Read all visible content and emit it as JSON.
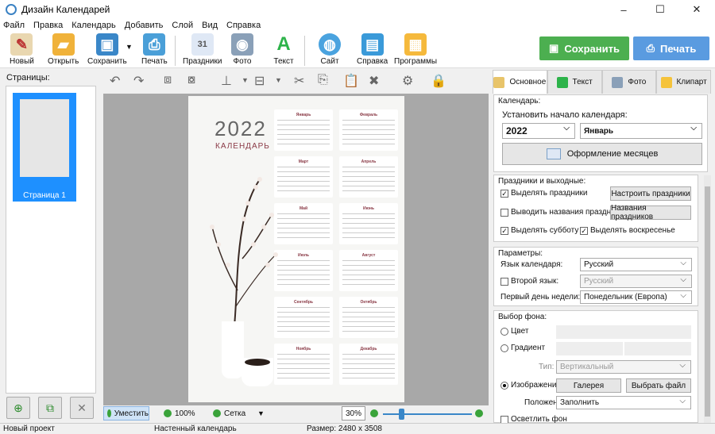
{
  "window": {
    "title": "Дизайн Календарей",
    "controls": [
      "–",
      "☐",
      "✕"
    ]
  },
  "menu": [
    "Файл",
    "Правка",
    "Календарь",
    "Добавить",
    "Слой",
    "Вид",
    "Справка"
  ],
  "toolbar": {
    "new": "Новый",
    "open": "Открыть",
    "save": "Сохранить",
    "print": "Печать",
    "holidays": "Праздники",
    "photo": "Фото",
    "text": "Текст",
    "site": "Сайт",
    "help": "Справка",
    "programs": "Программы",
    "save_big": "Сохранить",
    "print_big": "Печать"
  },
  "colors": {
    "save_big": "#4caf50",
    "print_big": "#5a9be0",
    "accent": "#1e90ff"
  },
  "left": {
    "pages_label": "Страницы:",
    "page1": "Страница 1"
  },
  "poster": {
    "year": "2022",
    "subtitle": "КАЛЕНДАРЬ",
    "months": [
      "Январь",
      "Февраль",
      "Март",
      "Апрель",
      "Май",
      "Июнь",
      "Июль",
      "Август",
      "Сентябрь",
      "Октябрь",
      "Ноябрь",
      "Декабрь"
    ]
  },
  "bottom": {
    "fit": "Уместить",
    "zoom100": "100%",
    "grid": "Сетка",
    "zoom": "30%"
  },
  "tabs": [
    "Основное",
    "Текст",
    "Фото",
    "Клипарт"
  ],
  "calendar": {
    "label": "Календарь:",
    "start_label": "Установить начало календаря:",
    "year": "2022",
    "month": "Январь",
    "design_btn": "Оформление месяцев"
  },
  "holidays": {
    "label": "Праздники и выходные:",
    "highlight": "Выделять праздники",
    "setup_btn": "Настроить праздники",
    "show_names": "Выводить названия праздников",
    "names_btn": "Названия праздников",
    "saturday": "Выделять субботу",
    "sunday": "Выделять воскресенье"
  },
  "params": {
    "label": "Параметры:",
    "lang_label": "Язык календаря:",
    "lang": "Русский",
    "second_lang": "Второй язык:",
    "second_lang_value": "Русский",
    "first_day_label": "Первый день недели:",
    "first_day": "Понедельник (Европа)"
  },
  "background": {
    "label": "Выбор фона:",
    "color": "Цвет",
    "gradient": "Градиент",
    "type_label": "Тип:",
    "type_value": "Вертикальный",
    "image": "Изображение",
    "gallery_btn": "Галерея",
    "file_btn": "Выбрать файл",
    "position_label": "Положение:",
    "position_value": "Заполнить",
    "lighten": "Осветлить фон"
  },
  "status": {
    "project": "Новый проект",
    "type": "Настенный календарь",
    "size": "Размер: 2480 x 3508"
  }
}
